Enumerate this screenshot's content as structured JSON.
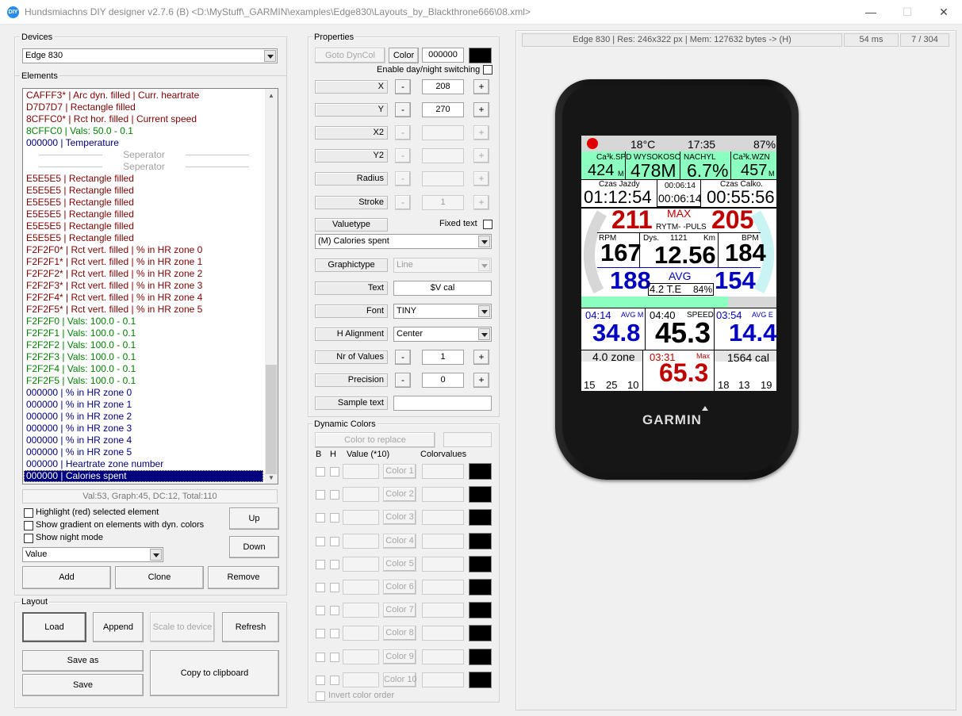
{
  "window": {
    "title": "Hundsmiachns DIY designer v2.7.6 (B) <D:\\MyStuff\\_GARMIN\\examples\\Edge830\\Layouts_by_Blackthrone666\\08.xml>",
    "icon_text": "DIY",
    "minimize": "—",
    "maximize": "☐",
    "close": "✕"
  },
  "devices": {
    "label": "Devices",
    "selected": "Edge 830"
  },
  "elements": {
    "label": "Elements",
    "items": [
      {
        "text": "CAFFF3* | Arc dyn. filled | Curr. heartrate",
        "color": "#800000"
      },
      {
        "text": "D7D7D7 | Rectangle filled",
        "color": "#800000"
      },
      {
        "text": "8CFFC0* | Rct hor. filled | Current speed",
        "color": "#800000"
      },
      {
        "text": "8CFFC0 | Vals: 50.0 - 0.1",
        "color": "#008000"
      },
      {
        "text": "000000 | Temperature",
        "color": "#000080"
      },
      {
        "text": "Seperator",
        "color": "#a0a0a0",
        "sep": true
      },
      {
        "text": "Seperator",
        "color": "#a0a0a0",
        "sep": true
      },
      {
        "text": "E5E5E5 | Rectangle filled",
        "color": "#800000"
      },
      {
        "text": "E5E5E5 | Rectangle filled",
        "color": "#800000"
      },
      {
        "text": "E5E5E5 | Rectangle filled",
        "color": "#800000"
      },
      {
        "text": "E5E5E5 | Rectangle filled",
        "color": "#800000"
      },
      {
        "text": "E5E5E5 | Rectangle filled",
        "color": "#800000"
      },
      {
        "text": "E5E5E5 | Rectangle filled",
        "color": "#800000"
      },
      {
        "text": "F2F2F0* | Rct vert. filled | % in HR zone 0",
        "color": "#800000"
      },
      {
        "text": "F2F2F1* | Rct vert. filled | % in HR zone 1",
        "color": "#800000"
      },
      {
        "text": "F2F2F2* | Rct vert. filled | % in HR zone 2",
        "color": "#800000"
      },
      {
        "text": "F2F2F3* | Rct vert. filled | % in HR zone 3",
        "color": "#800000"
      },
      {
        "text": "F2F2F4* | Rct vert. filled | % in HR zone 4",
        "color": "#800000"
      },
      {
        "text": "F2F2F5* | Rct vert. filled | % in HR zone 5",
        "color": "#800000"
      },
      {
        "text": "F2F2F0 | Vals: 100.0 - 0.1",
        "color": "#008000"
      },
      {
        "text": "F2F2F1 | Vals: 100.0 - 0.1",
        "color": "#008000"
      },
      {
        "text": "F2F2F2 | Vals: 100.0 - 0.1",
        "color": "#008000"
      },
      {
        "text": "F2F2F3 | Vals: 100.0 - 0.1",
        "color": "#008000"
      },
      {
        "text": "F2F2F4 | Vals: 100.0 - 0.1",
        "color": "#008000"
      },
      {
        "text": "F2F2F5 | Vals: 100.0 - 0.1",
        "color": "#008000"
      },
      {
        "text": "000000 | % in HR zone 0",
        "color": "#000080"
      },
      {
        "text": "000000 | % in HR zone 1",
        "color": "#000080"
      },
      {
        "text": "000000 | % in HR zone 2",
        "color": "#000080"
      },
      {
        "text": "000000 | % in HR zone 3",
        "color": "#000080"
      },
      {
        "text": "000000 | % in HR zone 4",
        "color": "#000080"
      },
      {
        "text": "000000 | % in HR zone 5",
        "color": "#000080"
      },
      {
        "text": "000000 | Heartrate zone number",
        "color": "#000080"
      },
      {
        "text": "000000 | Calories spent",
        "color": "#ffffff",
        "selected": true
      }
    ],
    "stats": "Val:53, Graph:45, DC:12, Total:110",
    "highlight": "Highlight (red) selected element",
    "gradient": "Show gradient on elements with dyn. colors",
    "night": "Show night mode",
    "up": "Up",
    "down": "Down",
    "filter": "Value",
    "add": "Add",
    "clone": "Clone",
    "remove": "Remove"
  },
  "layout": {
    "label": "Layout",
    "load": "Load",
    "append": "Append",
    "scale": "Scale to device",
    "refresh": "Refresh",
    "save_as": "Save as",
    "save": "Save",
    "copy": "Copy to clipboard"
  },
  "properties": {
    "label": "Properties",
    "goto": "Goto DynCol",
    "color_btn": "Color",
    "color_value": "000000",
    "daynight": "Enable day/night switching",
    "x_label": "X",
    "x_value": "208",
    "y_label": "Y",
    "y_value": "270",
    "x2_label": "X2",
    "y2_label": "Y2",
    "radius_label": "Radius",
    "stroke_label": "Stroke",
    "stroke_value": "1",
    "minus": "-",
    "plus": "+",
    "valuetype_label": "Valuetype",
    "fixed_text": "Fixed text",
    "valuetype": "(M) Calories spent",
    "graphictype_label": "Graphictype",
    "graphictype": "Line",
    "text_label": "Text",
    "text_value": "$V cal",
    "font_label": "Font",
    "font_value": "TINY",
    "halign_label": "H Alignment",
    "halign_value": "Center",
    "nrvalues_label": "Nr of Values",
    "nrvalues_value": "1",
    "precision_label": "Precision",
    "precision_value": "0",
    "sample_label": "Sample text"
  },
  "dynamic": {
    "label": "Dynamic Colors",
    "replace": "Color to replace",
    "b": "B",
    "h": "H",
    "value_hdr": "Value (*10)",
    "colorvalues_hdr": "Colorvalues",
    "rows": [
      "Color 1",
      "Color 2",
      "Color 3",
      "Color 4",
      "Color 5",
      "Color 6",
      "Color 7",
      "Color 8",
      "Color 9",
      "Color 10"
    ],
    "invert": "Invert color order"
  },
  "preview": {
    "info": "Edge 830 | Res: 246x322 px | Mem: 127632 bytes -> (H)",
    "time": "54 ms",
    "count": "7 / 304",
    "brand": "GARMIN",
    "screen": {
      "temp": "18°C",
      "clock": "17:35",
      "battery": "87%",
      "r1": [
        {
          "l": "Ca³k.SPD",
          "v": "424",
          "u": "M"
        },
        {
          "l": "WYSOKOSC",
          "v": "478M",
          "u": ""
        },
        {
          "l": "NACHYL",
          "v": "6.7%",
          "u": ""
        },
        {
          "l": "Ca³k.WZN",
          "v": "457",
          "u": "M"
        }
      ],
      "czas_l": "Czas Jazdy",
      "czas_v": "01:12:54",
      "mid1": "00:06:14",
      "mid2": "00:06:14",
      "calk_l": "Czas Calko.",
      "calk_v": "00:55:56",
      "hr_l": "211",
      "max": "MAX",
      "hr_r": "205",
      "rytm": "RYTM- -PULS",
      "rpm_l": "RPM",
      "rpm": "167",
      "dys": "Dys.",
      "dys_n": "1121",
      "km": "Km",
      "dist": "12.56",
      "bpm_l": "BPM",
      "bpm": "184",
      "avg_l": "188",
      "avg": "AVG",
      "avg_r": "154",
      "te": "4.2 T.E",
      "pct": "84%",
      "t1": "04:14",
      "avgm": "AVG M",
      "s1": "34.8",
      "t2": "04:40",
      "speed": "SPEED",
      "s2": "45.3",
      "t3": "03:54",
      "avge": "AVG E",
      "s3": "14.4",
      "zone": "4.0 zone",
      "t4": "03:31",
      "maxs": "Max",
      "s4": "65.3",
      "cal": "1564 cal",
      "b1": "15",
      "b2": "25",
      "b3": "10",
      "b4": "18",
      "b5": "13",
      "b6": "19",
      "colors": {
        "green": "#8cffc0",
        "red": "#c00000",
        "blue": "#0000c0",
        "arc_grey": "#d7d7d7",
        "arc_cyan": "#caf3f3"
      }
    }
  }
}
